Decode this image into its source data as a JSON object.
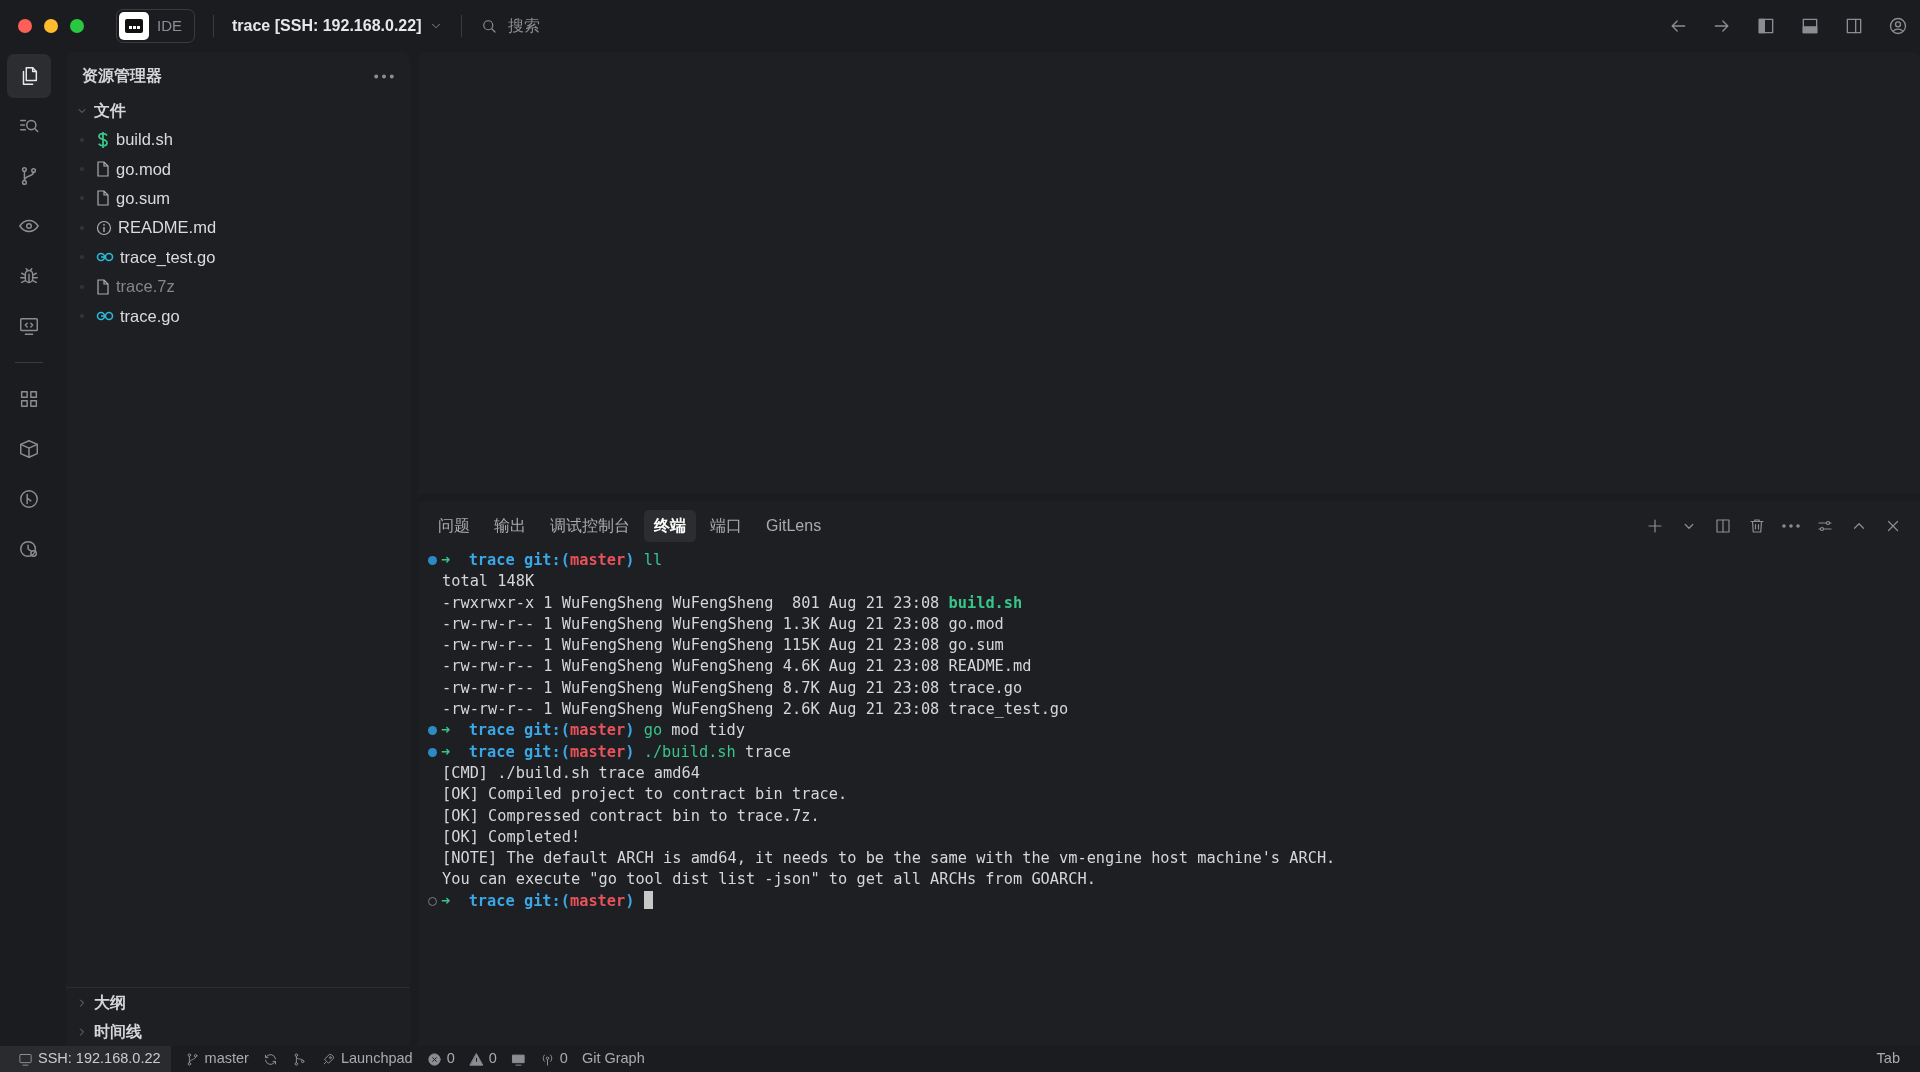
{
  "titlebar": {
    "mode": {
      "label": "IDE",
      "active": false
    },
    "title": "trace [SSH: 192.168.0.22]",
    "search": {
      "placeholder": "搜索"
    }
  },
  "activity_bar": [
    {
      "selected": true
    },
    {
      "selected": false
    },
    {
      "selected": false
    },
    {
      "selected": false
    },
    {
      "selected": false
    },
    {
      "selected": false
    },
    {
      "selected": false
    },
    {
      "selected": false
    },
    {
      "selected": false
    },
    {
      "selected": false
    }
  ],
  "sidebar": {
    "title": "资源管理器",
    "sections": [
      {
        "label": "文件",
        "expanded": true,
        "items": [
          {
            "name": "build.sh",
            "kind": "shell",
            "dimmed": false
          },
          {
            "name": "go.mod",
            "kind": "plain",
            "dimmed": false
          },
          {
            "name": "go.sum",
            "kind": "plain",
            "dimmed": false
          },
          {
            "name": "README.md",
            "kind": "readme",
            "dimmed": false
          },
          {
            "name": "trace_test.go",
            "kind": "go",
            "dimmed": false
          },
          {
            "name": "trace.7z",
            "kind": "plain",
            "dimmed": true
          },
          {
            "name": "trace.go",
            "kind": "go",
            "dimmed": false
          }
        ]
      },
      {
        "label": "大纲",
        "expanded": false
      },
      {
        "label": "时间线",
        "expanded": false
      }
    ]
  },
  "panel": {
    "tabs": [
      {
        "label": "问题",
        "selected": false
      },
      {
        "label": "输出",
        "selected": false
      },
      {
        "label": "调试控制台",
        "selected": false
      },
      {
        "label": "终端",
        "selected": true
      },
      {
        "label": "端口",
        "selected": false
      },
      {
        "label": "GitLens",
        "selected": false
      }
    ],
    "terminal": {
      "lines": [
        {
          "kind": "prompt",
          "finished": true,
          "arrow": "➜",
          "dir": "trace",
          "git": "git:(",
          "branch": "master",
          "git_close": ")",
          "program": "ll"
        },
        {
          "kind": "output",
          "text": "total 148K"
        },
        {
          "kind": "listing",
          "text": "-rwxrwxr-x 1 WuFengSheng WuFengSheng  801 Aug 21 23:08",
          "file": "build.sh",
          "executable": true
        },
        {
          "kind": "listing",
          "text": "-rw-rw-r-- 1 WuFengSheng WuFengSheng 1.3K Aug 21 23:08",
          "file": "go.mod",
          "executable": false
        },
        {
          "kind": "listing",
          "text": "-rw-rw-r-- 1 WuFengSheng WuFengSheng 115K Aug 21 23:08",
          "file": "go.sum",
          "executable": false
        },
        {
          "kind": "listing",
          "text": "-rw-rw-r-- 1 WuFengSheng WuFengSheng 4.6K Aug 21 23:08",
          "file": "README.md",
          "executable": false
        },
        {
          "kind": "listing",
          "text": "-rw-rw-r-- 1 WuFengSheng WuFengSheng 8.7K Aug 21 23:08",
          "file": "trace.go",
          "executable": false
        },
        {
          "kind": "listing",
          "text": "-rw-rw-r-- 1 WuFengSheng WuFengSheng 2.6K Aug 21 23:08",
          "file": "trace_test.go",
          "executable": false
        },
        {
          "kind": "prompt",
          "finished": true,
          "arrow": "➜",
          "dir": "trace",
          "git": "git:(",
          "branch": "master",
          "git_close": ")",
          "program": "go",
          "args": "mod tidy"
        },
        {
          "kind": "prompt",
          "finished": true,
          "arrow": "➜",
          "dir": "trace",
          "git": "git:(",
          "branch": "master",
          "git_close": ")",
          "program": "./build.sh",
          "args": "trace"
        },
        {
          "kind": "output",
          "text": "[CMD] ./build.sh trace amd64"
        },
        {
          "kind": "output",
          "text": "[OK] Compiled project to contract bin trace."
        },
        {
          "kind": "output",
          "text": "[OK] Compressed contract bin to trace.7z."
        },
        {
          "kind": "output",
          "text": "[OK] Completed!"
        },
        {
          "kind": "output",
          "text": "[NOTE] The default ARCH is amd64, it needs to be the same with the vm-engine host machine's ARCH."
        },
        {
          "kind": "output",
          "text": "You can execute \"go tool dist list -json\" to get all ARCHs from GOARCH."
        },
        {
          "kind": "prompt",
          "finished": false,
          "arrow": "➜",
          "dir": "trace",
          "git": "git:(",
          "branch": "master",
          "git_close": ")",
          "cursor": true
        }
      ]
    }
  },
  "status_bar": [
    {
      "kind": "remote",
      "text": "SSH: 192.168.0.22"
    },
    {
      "kind": "branch",
      "text": "master"
    },
    {
      "kind": "sync"
    },
    {
      "kind": "merge"
    },
    {
      "kind": "launch",
      "text": "Launchpad"
    },
    {
      "kind": "errors",
      "text": "0"
    },
    {
      "kind": "warnings",
      "text": "0"
    },
    {
      "kind": "screen"
    },
    {
      "kind": "ports",
      "text": "0"
    },
    {
      "kind": "plain",
      "text": "Git Graph"
    }
  ],
  "status_right": "Tab"
}
